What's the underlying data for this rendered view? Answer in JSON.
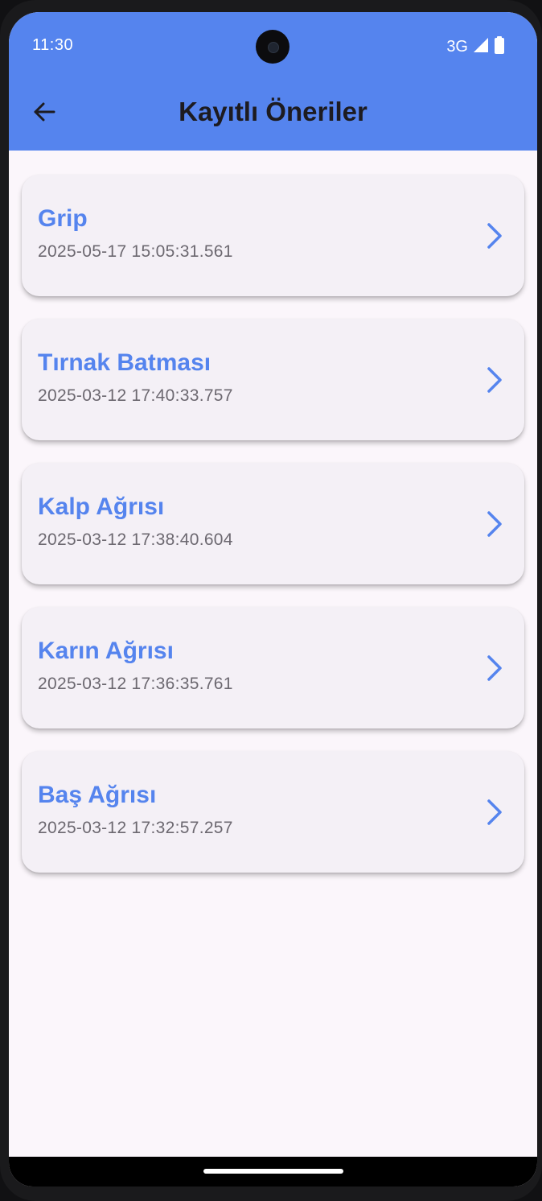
{
  "status_bar": {
    "time": "11:30",
    "network": "3G"
  },
  "header": {
    "title": "Kayıtlı Öneriler"
  },
  "suggestions": [
    {
      "title": "Grip",
      "date": "2025-05-17 15:05:31.561"
    },
    {
      "title": "Tırnak Batması",
      "date": "2025-03-12 17:40:33.757"
    },
    {
      "title": "Kalp Ağrısı",
      "date": "2025-03-12 17:38:40.604"
    },
    {
      "title": "Karın Ağrısı",
      "date": "2025-03-12 17:36:35.761"
    },
    {
      "title": "Baş Ağrısı",
      "date": "2025-03-12 17:32:57.257"
    }
  ],
  "colors": {
    "app_bar": "#5584ee",
    "accent": "#5584ee",
    "background": "#fbf6fb",
    "card": "#f4f0f6",
    "title_text": "#1d1b20",
    "date_text": "#6c6870"
  },
  "icons": {
    "back": "arrow-back-icon",
    "item_chevron": "chevron-right-icon",
    "signal": "signal-icon",
    "battery": "battery-icon"
  }
}
